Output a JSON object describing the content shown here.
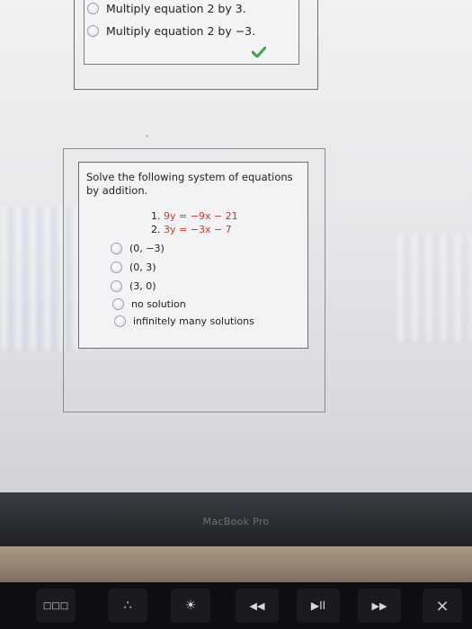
{
  "question_prev": {
    "options": [
      "Multiply equation 2 by 3.",
      "Multiply equation 2 by −3."
    ],
    "check_mark": "✔",
    "check_color": "#3aa648"
  },
  "question": {
    "prompt": "Solve the following system of equations by addition.",
    "equations": [
      {
        "num": "1.",
        "lhs": "9y",
        "rest": "= −9x − 21"
      },
      {
        "num": "2.",
        "lhs": "3y",
        "rest": "= −3x − 7"
      }
    ],
    "options": [
      "(0, −3)",
      "(0, 3)",
      "(3, 0)",
      "no solution",
      "infinitely many solutions"
    ]
  },
  "laptop": {
    "brand": "MacBook Pro"
  },
  "touchbar": {
    "keys": [
      "□□□",
      "∴",
      "☀",
      "◀◀",
      "▶II",
      "▶▶",
      "×"
    ]
  },
  "colors": {
    "equation_red": "#c0392b"
  }
}
